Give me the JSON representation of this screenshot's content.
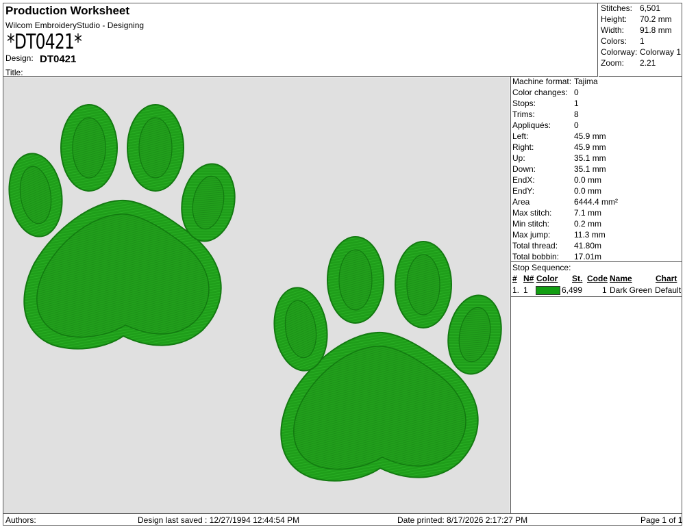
{
  "header": {
    "title": "Production Worksheet",
    "software": "Wilcom EmbroideryStudio - Designing",
    "file_name": "*DT0421*",
    "design_label": "Design:",
    "design_value": "DT0421",
    "title_label": "Title:"
  },
  "stats": [
    {
      "label": "Stitches:",
      "value": "6,501"
    },
    {
      "label": "Height:",
      "value": "70.2 mm"
    },
    {
      "label": "Width:",
      "value": "91.8 mm"
    },
    {
      "label": "Colors:",
      "value": "1"
    },
    {
      "label": "Colorway:",
      "value": "Colorway 1"
    },
    {
      "label": "Zoom:",
      "value": "2.21"
    }
  ],
  "info": [
    {
      "label": "Machine format:",
      "value": "Tajima"
    },
    {
      "label": "Color changes:",
      "value": "0"
    },
    {
      "label": "Stops:",
      "value": "1"
    },
    {
      "label": "Trims:",
      "value": "8"
    },
    {
      "label": "Appliqués:",
      "value": "0"
    },
    {
      "label": "Left:",
      "value": "45.9 mm"
    },
    {
      "label": "Right:",
      "value": "45.9 mm"
    },
    {
      "label": "Up:",
      "value": "35.1 mm"
    },
    {
      "label": "Down:",
      "value": "35.1 mm"
    },
    {
      "label": "EndX:",
      "value": "0.0 mm"
    },
    {
      "label": "EndY:",
      "value": "0.0 mm"
    },
    {
      "label": "Area",
      "value": "6444.4 mm²"
    },
    {
      "label": "Max stitch:",
      "value": "7.1 mm"
    },
    {
      "label": "Min stitch:",
      "value": "0.2 mm"
    },
    {
      "label": "Max jump:",
      "value": "11.3 mm"
    },
    {
      "label": "Total thread:",
      "value": "41.80m"
    },
    {
      "label": "Total bobbin:",
      "value": "17.01m"
    }
  ],
  "stop_sequence": {
    "label": "Stop Sequence:",
    "columns": [
      "#",
      "N#",
      "Color",
      "St.",
      "Code",
      "Name",
      "Chart"
    ],
    "rows": [
      {
        "num": "1.",
        "n": "1",
        "color": "#139e13",
        "stitches": "6,499",
        "code": "1",
        "name": "Dark Green",
        "chart": "Default"
      }
    ]
  },
  "footer": {
    "authors": "Authors:",
    "last_saved": "Design last saved : 12/27/1994 12:44:54 PM",
    "printed": "Date printed: 8/17/2026 2:17:27 PM",
    "page": "Page 1 of 1"
  },
  "colors": {
    "thread": "#1f9e1a",
    "thread_dark": "#127a10",
    "thread_light": "#3dc832",
    "canvas": "#e0e0e0"
  }
}
